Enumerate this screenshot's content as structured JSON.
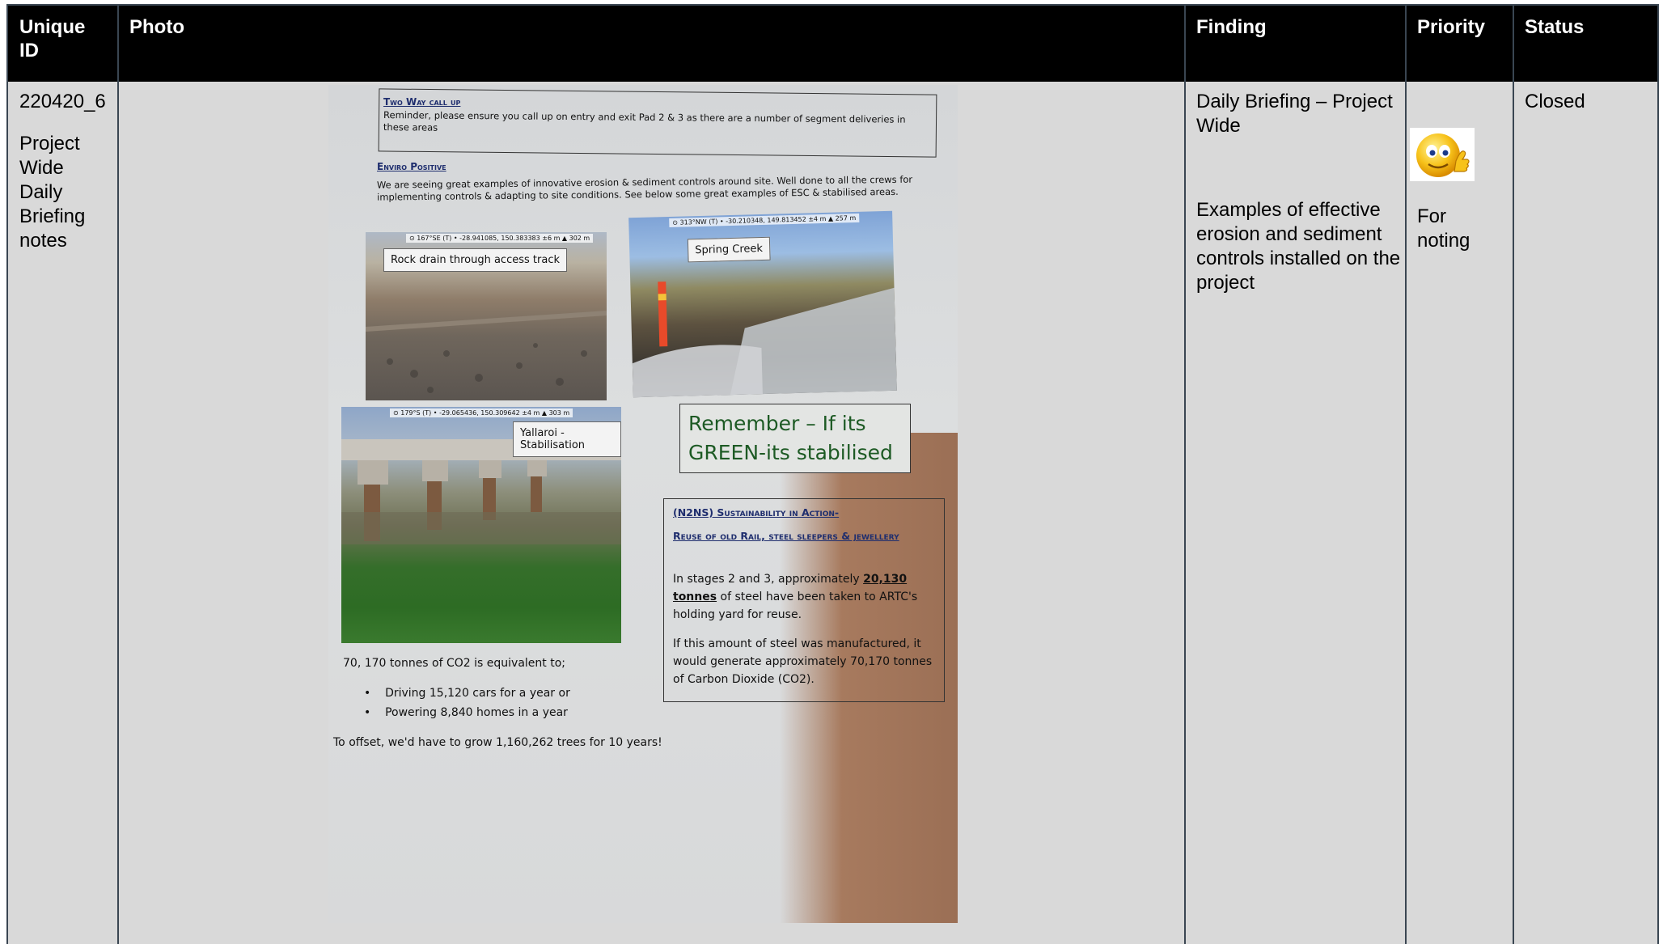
{
  "table": {
    "headers": {
      "id": "Unique ID",
      "photo": "Photo",
      "finding": "Finding",
      "priority": "Priority",
      "status": "Status"
    },
    "row": {
      "id": "220420_6",
      "id_desc": "Project Wide Daily Briefing notes",
      "finding_title": "Daily Briefing – Project Wide",
      "finding_detail": "Examples of effective erosion and sediment controls installed on the project",
      "priority_icon": "thumbs-up-smiley-icon",
      "priority_text": "For noting",
      "status": "Closed"
    }
  },
  "document": {
    "two_way_title": "Two Way call up",
    "two_way_body": "Reminder, please ensure you call up on entry and exit Pad 2 & 3 as there are a number of segment deliveries in these areas",
    "enviro_title": "Enviro Positive",
    "enviro_body": "We are seeing great examples of innovative erosion & sediment controls around site. Well done to all the crews for implementing controls & adapting to site conditions. See below some great examples of ESC & stabilised areas.",
    "photo1_geo": "⊙ 167°SE (T) • -28.941085, 150.383383 ±6 m ▲ 302 m",
    "photo1_label": "Rock drain through access track",
    "photo2_geo": "⊙ 313°NW (T) • -30.210348, 149.813452 ±4 m ▲ 257 m",
    "photo2_label": "Spring Creek",
    "photo3_geo": "⊙ 179°S (T) • -29.065436, 150.309642 ±4 m ▲ 303 m",
    "photo3_label": "Yallaroi - Stabilisation",
    "remember": "Remember – If its GREEN-its stabilised",
    "n2ns_title_1": "(N2NS) Sustainability in Action-",
    "n2ns_title_2": "Reuse of old Rail, steel sleepers & jewellery",
    "n2ns_p1_a": "In stages 2 and 3, approximately ",
    "n2ns_p1_b": "20,130 tonnes",
    "n2ns_p1_c": " of steel have been taken to ARTC's holding yard for reuse.",
    "n2ns_p2": "If this amount of steel was manufactured, it would generate approximately 70,170 tonnes of Carbon Dioxide (CO2).",
    "co2_line": "70, 170 tonnes of CO2 is equivalent to;",
    "bullet1": "Driving 15,120 cars for a year or",
    "bullet2": "Powering 8,840 homes in a year",
    "offset": "To offset, we'd have to grow 1,160,262 trees for 10 years!"
  }
}
